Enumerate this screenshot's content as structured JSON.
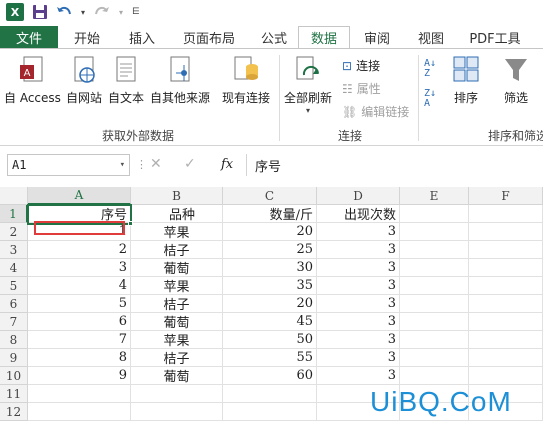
{
  "qat": {
    "app_icon": "X",
    "save": "save-icon",
    "undo": "undo-icon",
    "redo": "redo-icon"
  },
  "tabs": [
    {
      "label": "文件"
    },
    {
      "label": "开始"
    },
    {
      "label": "插入"
    },
    {
      "label": "页面布局"
    },
    {
      "label": "公式"
    },
    {
      "label": "数据"
    },
    {
      "label": "审阅"
    },
    {
      "label": "视图"
    },
    {
      "label": "PDF工具"
    }
  ],
  "ribbon": {
    "from_access": "自 Access",
    "from_web": "自网站",
    "from_text": "自文本",
    "from_other": "自其他来源",
    "existing_conn": "现有连接",
    "refresh_all": "全部刷新",
    "connections": "连接",
    "properties": "属性",
    "edit_links": "编辑链接",
    "sort": "排序",
    "filter": "筛选",
    "group_external": "获取外部数据",
    "group_conn": "连接",
    "group_sort": "排序和筛选"
  },
  "formula_bar": {
    "name_box": "A1",
    "fx": "fx",
    "content": "序号"
  },
  "columns": [
    "A",
    "B",
    "C",
    "D",
    "E",
    "F"
  ],
  "rows": [
    "1",
    "2",
    "3",
    "4",
    "5",
    "6",
    "7",
    "8",
    "9",
    "10",
    "11",
    "12"
  ],
  "sheet": [
    [
      "序号",
      "品种",
      "数量/斤",
      "出现次数"
    ],
    [
      "1",
      "苹果",
      "20",
      "3"
    ],
    [
      "2",
      "桔子",
      "25",
      "3"
    ],
    [
      "3",
      "葡萄",
      "30",
      "3"
    ],
    [
      "4",
      "苹果",
      "35",
      "3"
    ],
    [
      "5",
      "桔子",
      "20",
      "3"
    ],
    [
      "6",
      "葡萄",
      "45",
      "3"
    ],
    [
      "7",
      "苹果",
      "50",
      "3"
    ],
    [
      "8",
      "桔子",
      "55",
      "3"
    ],
    [
      "9",
      "葡萄",
      "60",
      "3"
    ]
  ],
  "watermark": "UiBQ.CoM",
  "colors": {
    "excel_green": "#217346",
    "selection_red": "#e03c3c",
    "watermark_blue": "#1c8fd6"
  }
}
